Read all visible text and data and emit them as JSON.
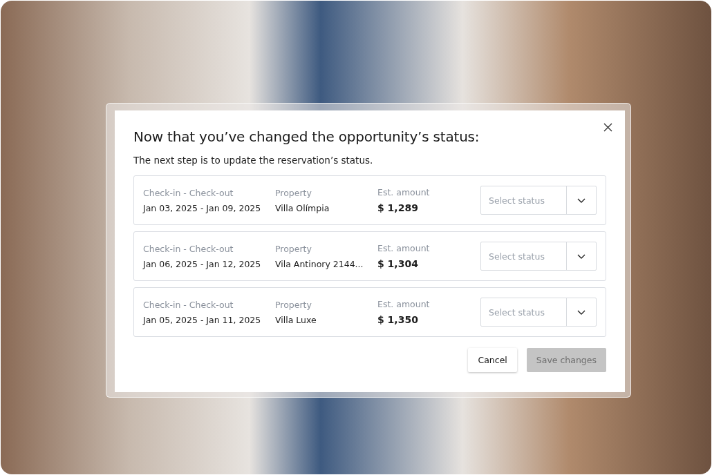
{
  "dialog": {
    "title": "Now that you’ve changed the opportunity’s status:",
    "subtitle": "The next step is to update the reservation’s status.",
    "reservations": [
      {
        "dates_label": "Check-in - Check-out",
        "dates": "Jan 03, 2025 - Jan 09, 2025",
        "property_label": "Property",
        "property": "Villa Olímpia",
        "amount_label": "Est. amount",
        "amount": "$ 1,289",
        "status": {
          "placeholder": "Select status"
        }
      },
      {
        "dates_label": "Check-in - Check-out",
        "dates": "Jan 06, 2025 - Jan 12, 2025",
        "property_label": "Property",
        "property": "Vila Antinory 2144...",
        "amount_label": "Est. amount",
        "amount": "$ 1,304",
        "status": {
          "placeholder": "Select status"
        }
      },
      {
        "dates_label": "Check-in - Check-out",
        "dates": "Jan 05, 2025 - Jan 11, 2025",
        "property_label": "Property",
        "property": "Villa Luxe",
        "amount_label": "Est. amount",
        "amount": "$ 1,350",
        "status": {
          "placeholder": "Select status"
        }
      }
    ],
    "buttons": [
      {
        "label": "Cancel",
        "kind": "secondary",
        "disabled": false
      },
      {
        "label": "Save changes",
        "kind": "primary",
        "disabled": true
      }
    ]
  }
}
